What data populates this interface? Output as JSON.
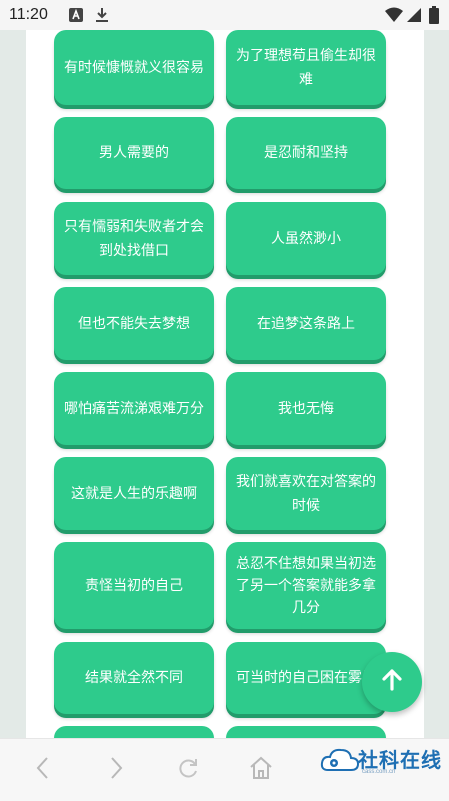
{
  "status_bar": {
    "time": "11:20",
    "icons": [
      "a-box-icon",
      "download-icon",
      "wifi-icon",
      "signal-icon",
      "battery-icon"
    ]
  },
  "phrases": [
    [
      "有时候慷慨就义很容易",
      "为了理想苟且偷生却很难"
    ],
    [
      "男人需要的",
      "是忍耐和坚持"
    ],
    [
      "只有懦弱和失败者才会到处找借口",
      "人虽然渺小"
    ],
    [
      "但也不能失去梦想",
      "在追梦这条路上"
    ],
    [
      "哪怕痛苦流涕艰难万分",
      "我也无悔"
    ],
    [
      "这就是人生的乐趣啊",
      "我们就喜欢在对答案的时候"
    ],
    [
      "责怪当初的自己",
      "总忍不住想如果当初选了另一个答案就能多拿几分"
    ],
    [
      "结果就全然不同",
      "可当时的自己困在雾里"
    ]
  ],
  "fab": {
    "icon": "arrow-up-icon"
  },
  "navbar": {
    "buttons": [
      "back-icon",
      "forward-icon",
      "refresh-icon",
      "home-icon"
    ]
  },
  "watermark": {
    "text": "社科在线",
    "sub": "cass.com.cn"
  },
  "colors": {
    "card": "#2ecb8c",
    "card_shadow": "#229c6b",
    "frame": "#e3eae7",
    "watermark": "#1e6fb3"
  }
}
